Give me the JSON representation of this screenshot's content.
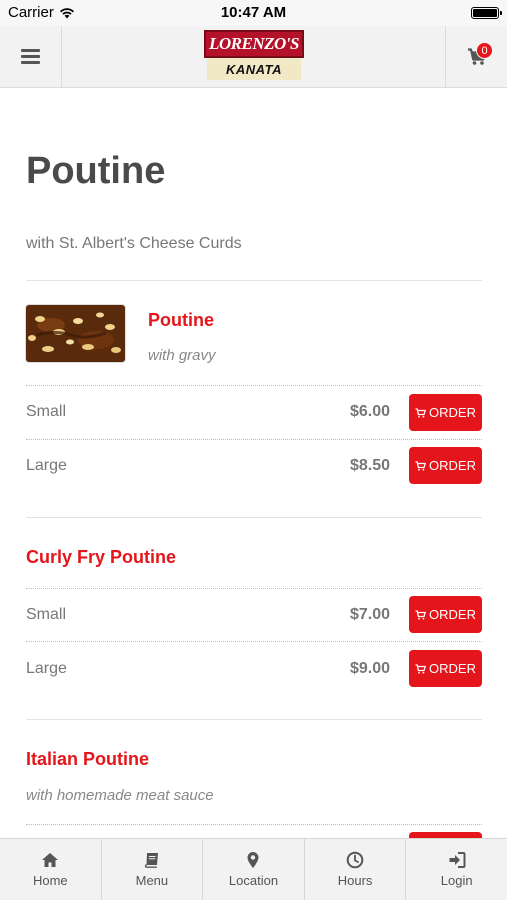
{
  "status_bar": {
    "carrier": "Carrier",
    "time": "10:47 AM"
  },
  "header": {
    "logo_top": "LORENZO'S",
    "logo_bottom": "KANATA",
    "cart_count": "0"
  },
  "page": {
    "title": "Poutine",
    "subtitle": "with St. Albert's Cheese Curds"
  },
  "items": [
    {
      "name": "Poutine",
      "description": "with gravy",
      "options": [
        {
          "size": "Small",
          "price": "$6.00",
          "button": "ORDER"
        },
        {
          "size": "Large",
          "price": "$8.50",
          "button": "ORDER"
        }
      ]
    },
    {
      "name": "Curly Fry Poutine",
      "options": [
        {
          "size": "Small",
          "price": "$7.00",
          "button": "ORDER"
        },
        {
          "size": "Large",
          "price": "$9.00",
          "button": "ORDER"
        }
      ]
    },
    {
      "name": "Italian Poutine",
      "description": "with homemade meat sauce"
    }
  ],
  "tabbar": {
    "tabs": [
      {
        "label": "Home",
        "icon": "home-icon"
      },
      {
        "label": "Menu",
        "icon": "book-icon"
      },
      {
        "label": "Location",
        "icon": "map-pin-icon"
      },
      {
        "label": "Hours",
        "icon": "clock-icon"
      },
      {
        "label": "Login",
        "icon": "login-icon"
      }
    ]
  },
  "colors": {
    "accent": "#e4161b",
    "logo_red": "#b3122a"
  }
}
